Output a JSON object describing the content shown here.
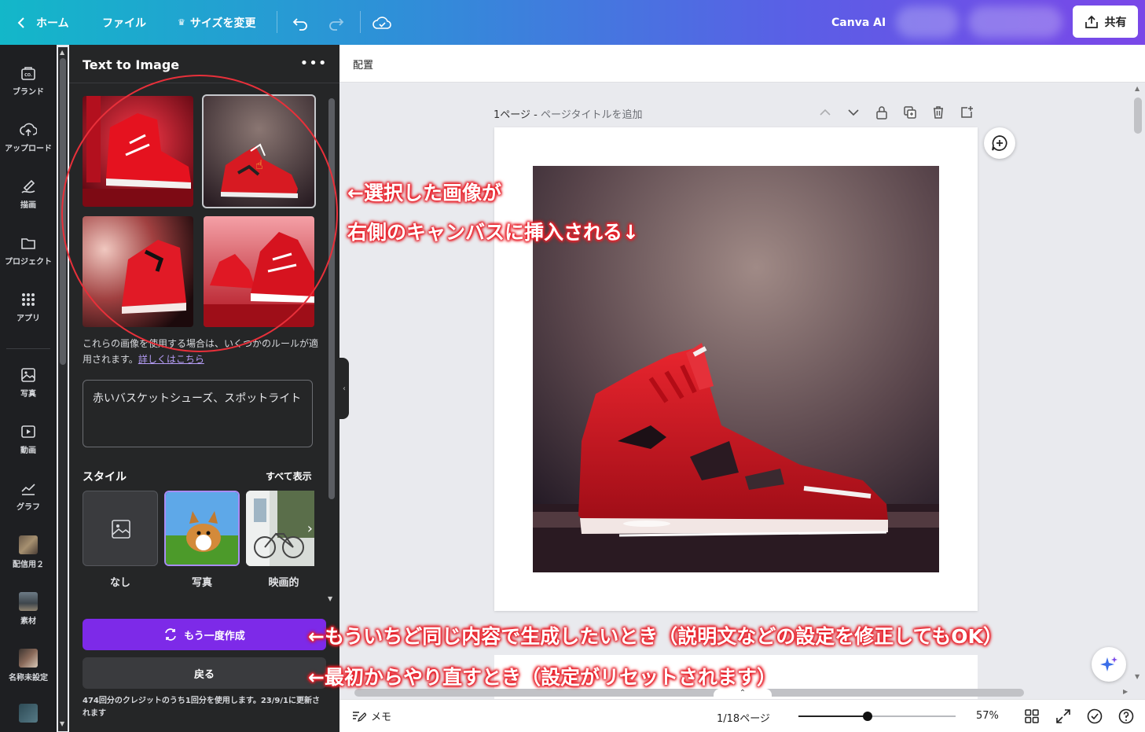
{
  "topbar": {
    "home": "ホーム",
    "file": "ファイル",
    "resize": "サイズを変更",
    "ai": "Canva AI",
    "share": "共有"
  },
  "rail": {
    "items": [
      {
        "label": "ブランド",
        "icon": "brand-icon"
      },
      {
        "label": "アップロード",
        "icon": "upload-cloud-icon"
      },
      {
        "label": "描画",
        "icon": "draw-icon"
      },
      {
        "label": "プロジェクト",
        "icon": "folder-icon"
      },
      {
        "label": "アプリ",
        "icon": "apps-grid-icon"
      },
      {
        "label": "写真",
        "icon": "photo-icon"
      },
      {
        "label": "動画",
        "icon": "video-icon"
      },
      {
        "label": "グラフ",
        "icon": "chart-icon"
      },
      {
        "label": "配信用２",
        "icon": "design-thumb"
      },
      {
        "label": "素材",
        "icon": "elements-thumb"
      },
      {
        "label": "名称未設定",
        "icon": "design-thumb"
      }
    ]
  },
  "panel": {
    "title": "Text to Image",
    "notice_text": "これらの画像を使用する場合は、いくつかのルールが適用されます。",
    "notice_link": "詳しくはこちら",
    "prompt": "赤いバスケットシューズ、スポットライト",
    "style_label": "スタイル",
    "style_all": "すべて表示",
    "styles": [
      {
        "name": "なし"
      },
      {
        "name": "写真"
      },
      {
        "name": "映画的"
      }
    ],
    "regen_label": "もう一度作成",
    "back_label": "戻る",
    "credits": "474回分のクレジットのうち1回分を使用します。23/9/1に更新されます"
  },
  "canvas": {
    "subbar_label": "配置",
    "page_label": "1ページ - ",
    "page_title_placeholder": "ページタイトルを追加"
  },
  "bottombar": {
    "memo": "メモ",
    "pages": "1/18ページ",
    "zoom": "57%",
    "zoom_level": 0.44
  },
  "annotations": {
    "a1": "←選択した画像が",
    "a2": "右側のキャンバスに挿入される↓",
    "a3": "←もういちど同じ内容で生成したいとき（説明文などの設定を修正してもOK）",
    "a4": "←最初からやり直すとき（設定がリセットされます）"
  },
  "colors": {
    "accent": "#7d2ae8",
    "annotation": "#e8202a"
  }
}
